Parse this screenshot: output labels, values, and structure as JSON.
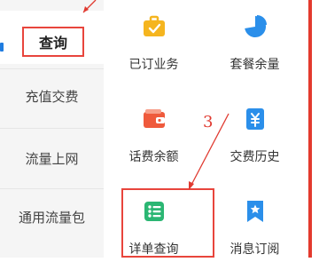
{
  "sidebar": {
    "items": [
      {
        "label": "查询"
      },
      {
        "label": "充值交费"
      },
      {
        "label": "流量上网"
      },
      {
        "label": "通用流量包"
      }
    ]
  },
  "grid": {
    "tiles": [
      {
        "label": "已订业务",
        "icon": "briefcase-check-icon",
        "color": "#f5b51f"
      },
      {
        "label": "套餐余量",
        "icon": "pie-chart-icon",
        "color": "#2b8fea"
      },
      {
        "label": "话费余额",
        "icon": "wallet-icon",
        "color": "#ef5a3c"
      },
      {
        "label": "交费历史",
        "icon": "yuan-receipt-icon",
        "color": "#2b8fea"
      },
      {
        "label": "详单查询",
        "icon": "list-detail-icon",
        "color": "#2bb673"
      },
      {
        "label": "消息订阅",
        "icon": "bookmark-star-icon",
        "color": "#2b8fea"
      }
    ]
  },
  "annotation": {
    "step_number": "3",
    "color": "#e03a30"
  }
}
